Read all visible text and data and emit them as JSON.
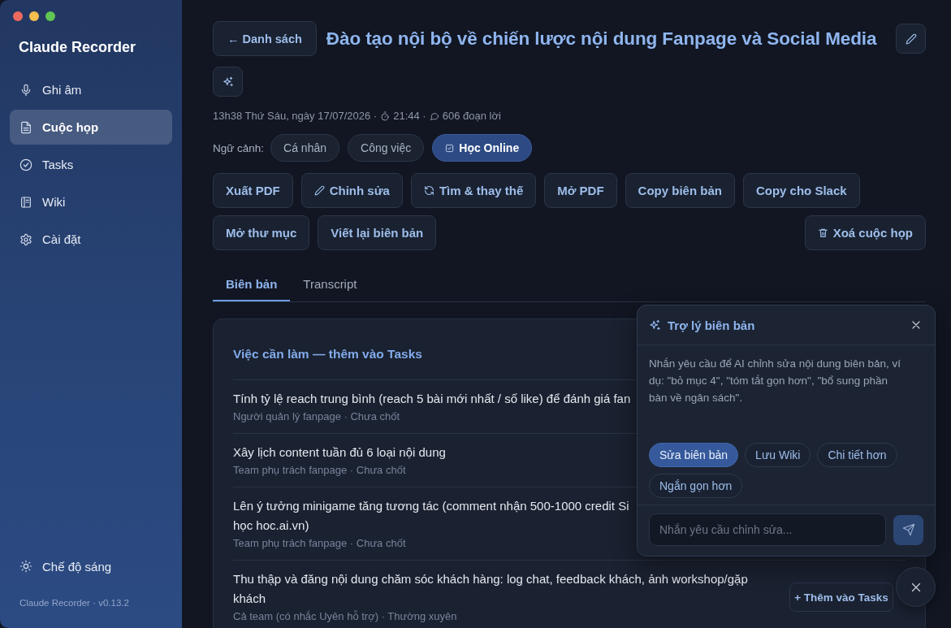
{
  "sidebar": {
    "app_name": "Claude Recorder",
    "items": [
      {
        "label": "Ghi âm",
        "kind": "recording",
        "selected": false
      },
      {
        "label": "Cuộc họp",
        "kind": "meetings",
        "selected": true
      },
      {
        "label": "Tasks",
        "kind": "tasks",
        "selected": false
      },
      {
        "label": "Wiki",
        "kind": "wiki",
        "selected": false
      },
      {
        "label": "Cài đặt",
        "kind": "settings",
        "selected": false
      }
    ],
    "theme_toggle": "Chế độ sáng",
    "version": "Claude Recorder · v0.13.2"
  },
  "header": {
    "back_button": "← Danh sách",
    "title": "Đào tạo nội bộ về chiến lược nội dung Fanpage và Social Media"
  },
  "meta": [
    {
      "kind": "date",
      "text": "13h38 Thứ Sáu, ngày 17/07/2026 ·"
    },
    {
      "kind": "duration",
      "text": "21:44 ·"
    },
    {
      "kind": "segments",
      "text": "606 đoạn lời"
    }
  ],
  "context": {
    "label": "Ngữ cảnh:",
    "chips": [
      {
        "label": "Cá nhân",
        "selected": false
      },
      {
        "label": "Công việc",
        "selected": false
      },
      {
        "label": "Học Online",
        "selected": true
      }
    ]
  },
  "actions": [
    {
      "label": "Xuất PDF",
      "kind": "plain"
    },
    {
      "label": "Chỉnh sửa",
      "kind": "edit"
    },
    {
      "label": "Tìm & thay thế",
      "kind": "replace"
    },
    {
      "label": "Mở PDF",
      "kind": "plain"
    },
    {
      "label": "Copy biên bản",
      "kind": "plain"
    },
    {
      "label": "Copy cho Slack",
      "kind": "plain"
    },
    {
      "label": "Mở thư mục",
      "kind": "plain"
    },
    {
      "label": "Viết lại biên bản",
      "kind": "plain"
    },
    {
      "label": "Xoá cuộc họp",
      "kind": "delete"
    }
  ],
  "tabs": [
    {
      "label": "Biên bản",
      "selected": true
    },
    {
      "label": "Transcript",
      "selected": false
    }
  ],
  "action_items": {
    "heading": "Việc cần làm — thêm vào Tasks",
    "items": [
      {
        "lines": [
          "Tính tỷ lệ reach trung bình (reach 5 bài mới nhất / số like) để đánh giá fan"
        ],
        "meta": "Người quản lý fanpage · Chưa chốt"
      },
      {
        "lines": [
          "Xây lịch content tuần đủ 6 loại nội dung"
        ],
        "meta": "Team phụ trách fanpage · Chưa chốt"
      },
      {
        "lines": [
          "Lên ý tưởng minigame tăng tương tác (comment nhận 500-1000 credit Si",
          "học hoc.ai.vn)"
        ],
        "meta": "Team phụ trách fanpage · Chưa chốt"
      },
      {
        "lines": [
          "Thu thập và đăng nội dung chăm sóc khách hàng: log chat, feedback khách, ảnh workshop/gặp khách"
        ],
        "meta": "Cả team (có nhắc Uyên hỗ trợ) · Thường xuyên",
        "add_button": "+ Thêm vào Tasks"
      }
    ]
  },
  "assistant": {
    "title": "Trợ lý biên bản",
    "hint": "Nhắn yêu cầu để AI chỉnh sửa nội dung biên bản, ví dụ: \"bỏ mục 4\", \"tóm tắt gọn hơn\", \"bổ sung phần bàn về ngân sách\".",
    "suggestions": [
      {
        "label": "Sửa biên bản",
        "selected": true
      },
      {
        "label": "Lưu Wiki",
        "selected": false
      },
      {
        "label": "Chi tiết hơn",
        "selected": false
      },
      {
        "label": "Ngắn gọn hơn",
        "selected": false
      }
    ],
    "input": {
      "placeholder": "Nhắn yêu cầu chỉnh sửa..."
    }
  }
}
